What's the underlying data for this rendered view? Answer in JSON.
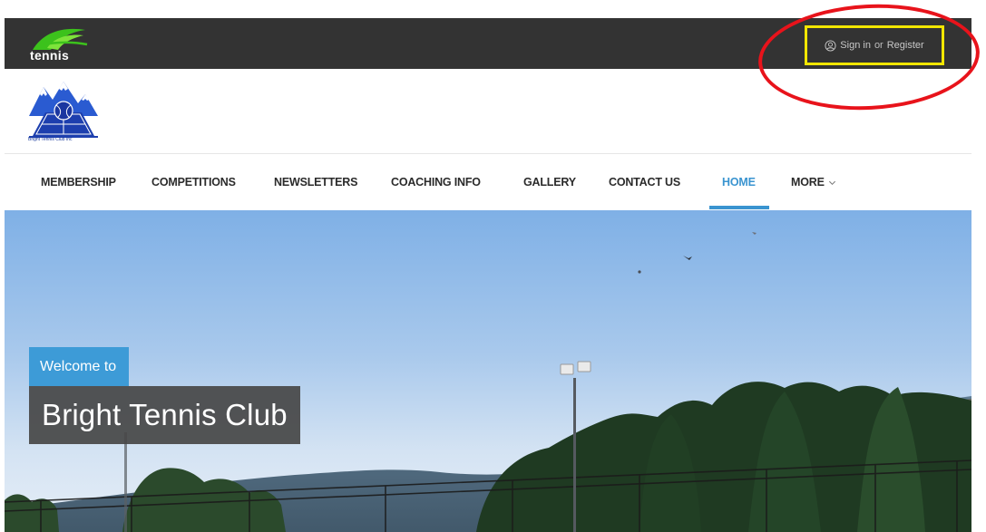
{
  "topbar": {
    "logo_text": "tennis",
    "sign_in_label": "Sign in",
    "separator": "or",
    "register_label": "Register",
    "highlight_color": "#f2e600",
    "annotation_color": "#e8131b"
  },
  "club": {
    "logo_caption": "Bright Tennis Club Inc"
  },
  "nav": {
    "items": [
      {
        "label": "MEMBERSHIP"
      },
      {
        "label": "COMPETITIONS"
      },
      {
        "label": "NEWSLETTERS"
      },
      {
        "label": "COACHING INFO"
      },
      {
        "label": "GALLERY"
      },
      {
        "label": "CONTACT US"
      },
      {
        "label": "HOME",
        "active": true
      },
      {
        "label": "MORE"
      }
    ],
    "active_color": "#3a94d0"
  },
  "hero": {
    "welcome_text": "Welcome to",
    "title_text": "Bright Tennis Club"
  }
}
